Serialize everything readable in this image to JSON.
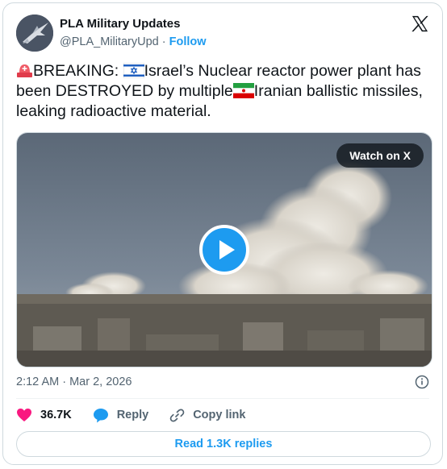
{
  "author": {
    "name": "PLA Military Updates",
    "handle": "@PLA_MilitaryUpd",
    "separator": "·",
    "follow_label": "Follow"
  },
  "tweet": {
    "segments": [
      {
        "icon": "alarm-emoji"
      },
      {
        "text": "BREAKING: "
      },
      {
        "icon": "israel-flag-emoji"
      },
      {
        "text": "Israel’s Nuclear reactor power plant has been DESTROYED by multiple"
      },
      {
        "icon": "iran-flag-emoji"
      },
      {
        "text": "Iranian ballistic missiles, leaking radioactive material."
      }
    ],
    "text_1": "BREAKING: ",
    "text_2": "Israel’s Nuclear reactor power plant has been DESTROYED by multiple",
    "text_3": "Iranian ballistic missiles, leaking radioactive material."
  },
  "media": {
    "watch_label": "Watch on X",
    "play_icon": "play-icon"
  },
  "meta": {
    "timestamp": "2:12 AM · Mar 2, 2026"
  },
  "actions": {
    "likes": "36.7K",
    "reply_label": "Reply",
    "copy_link_label": "Copy link"
  },
  "read_replies_label": "Read 1.3K replies",
  "colors": {
    "accent": "#1d9bf0",
    "like": "#f91880",
    "text": "#0f1419",
    "muted": "#536471",
    "border": "#cfd9de"
  }
}
